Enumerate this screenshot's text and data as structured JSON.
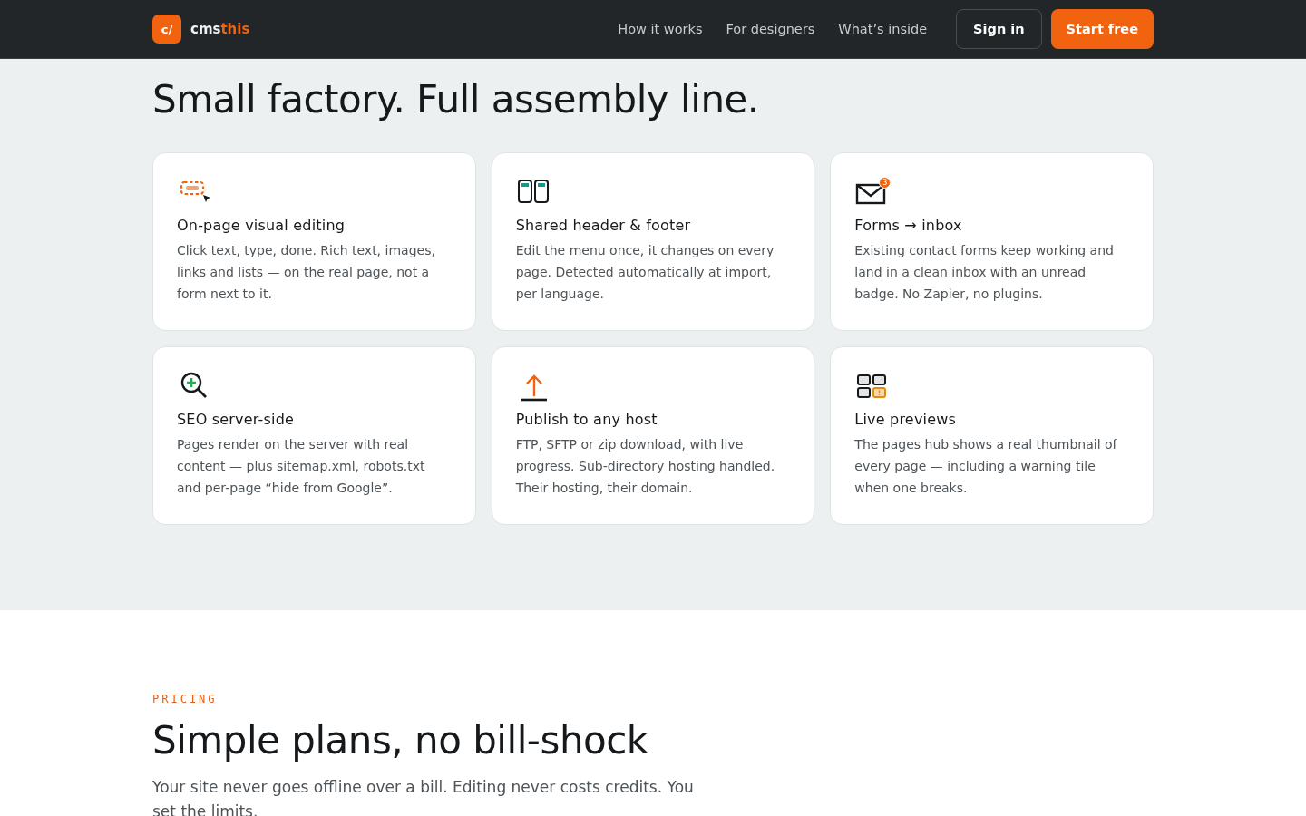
{
  "header": {
    "logo_mark": "c/",
    "brand": "cms",
    "brand_accent": "this",
    "nav": [
      "How it works",
      "For designers",
      "What’s inside"
    ],
    "sign_in": "Sign in",
    "cta": "Start free"
  },
  "features": {
    "title": "Small factory. Full assembly line.",
    "cards": [
      {
        "kind": "edit",
        "title": "On-page visual editing",
        "text": "Click text, type, done. Rich text, images, links and lists — on the real page, not a form next to it."
      },
      {
        "kind": "layout",
        "title": "Shared header & footer",
        "text": "Edit the menu once, it changes on every page. Detected automatically at import, per language."
      },
      {
        "kind": "mail",
        "badge": "3",
        "title": "Forms → inbox",
        "text": "Existing contact forms keep working and land in a clean inbox with an unread badge. No Zapier, no plugins."
      },
      {
        "kind": "seo",
        "title": "SEO server-side",
        "text": "Pages render on the server with real content — plus sitemap.xml, robots.txt and per-page “hide from Google”."
      },
      {
        "kind": "publish",
        "title": "Publish to any host",
        "text": "FTP, SFTP or zip download, with live progress. Sub-directory hosting handled. Their hosting, their domain."
      },
      {
        "kind": "previews",
        "title": "Live previews",
        "text": "The pages hub shows a real thumbnail of every page — including a warning tile when one breaks."
      }
    ]
  },
  "pricing": {
    "eyebrow": "PRICING",
    "title": "Simple plans, no bill-shock",
    "text": "Your site never goes offline over a bill. Editing never costs credits. You set the limits."
  }
}
